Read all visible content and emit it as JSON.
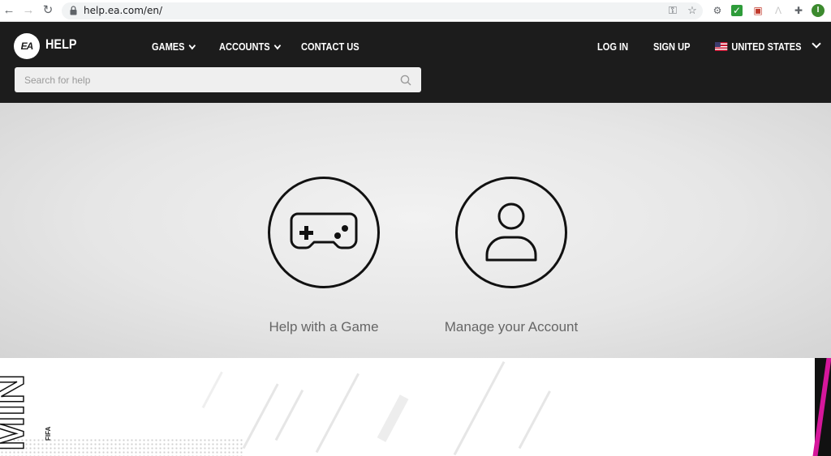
{
  "browser": {
    "url": "help.ea.com/en/",
    "profile_initial": "I"
  },
  "header": {
    "logo_text": "EA",
    "brand": "HELP",
    "nav": {
      "games": "GAMES",
      "accounts": "ACCOUNTS",
      "contact": "CONTACT US",
      "login": "LOG IN",
      "signup": "SIGN UP",
      "region": "UNITED STATES"
    },
    "search": {
      "placeholder": "Search for help"
    }
  },
  "hero": {
    "tiles": [
      {
        "label": "Help with a Game",
        "icon": "gamepad-icon"
      },
      {
        "label": "Manage your Account",
        "icon": "user-icon"
      }
    ]
  },
  "banner": {
    "big_text": "MIN",
    "small_text": "FIFA"
  },
  "colors": {
    "header_bg": "#1c1c1c",
    "accent_pink": "#d6179b",
    "profile_green": "#3c8a2e"
  }
}
